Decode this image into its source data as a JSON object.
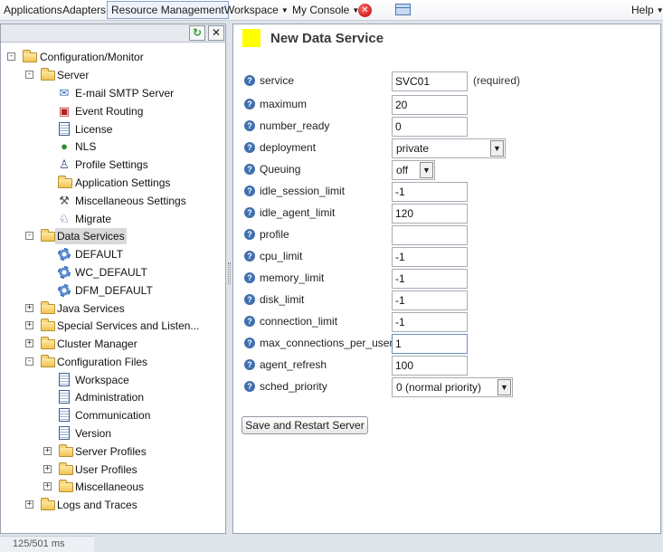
{
  "menu": {
    "applications": "Applications",
    "adapters": "Adapters",
    "resource_management": "Resource Management",
    "workspace": "Workspace",
    "my_console": "My Console",
    "help": "Help"
  },
  "tree": {
    "configuration_monitor": "Configuration/Monitor",
    "server": "Server",
    "email_smtp": "E-mail SMTP Server",
    "event_routing": "Event Routing",
    "license": "License",
    "nls": "NLS",
    "profile_settings": "Profile Settings",
    "application_settings": "Application Settings",
    "misc_settings": "Miscellaneous Settings",
    "migrate": "Migrate",
    "data_services": "Data Services",
    "default": "DEFAULT",
    "wc_default": "WC_DEFAULT",
    "dfm_default": "DFM_DEFAULT",
    "java_services": "Java Services",
    "special_services": "Special Services and Listen...",
    "cluster_manager": "Cluster Manager",
    "configuration_files": "Configuration Files",
    "cf_workspace": "Workspace",
    "cf_administration": "Administration",
    "cf_communication": "Communication",
    "cf_version": "Version",
    "server_profiles": "Server Profiles",
    "user_profiles": "User Profiles",
    "miscellaneous": "Miscellaneous",
    "logs_traces": "Logs and Traces"
  },
  "form": {
    "title": "New Data Service",
    "required_note": "(required)",
    "save_label": "Save and Restart Server",
    "fields": {
      "service": {
        "label": "service",
        "value": "SVC01"
      },
      "maximum": {
        "label": "maximum",
        "value": "20"
      },
      "number_ready": {
        "label": "number_ready",
        "value": "0"
      },
      "deployment": {
        "label": "deployment",
        "value": "private"
      },
      "queuing": {
        "label": "Queuing",
        "value": "off"
      },
      "idle_session_limit": {
        "label": "idle_session_limit",
        "value": "-1"
      },
      "idle_agent_limit": {
        "label": "idle_agent_limit",
        "value": "120"
      },
      "profile": {
        "label": "profile",
        "value": ""
      },
      "cpu_limit": {
        "label": "cpu_limit",
        "value": "-1"
      },
      "memory_limit": {
        "label": "memory_limit",
        "value": "-1"
      },
      "disk_limit": {
        "label": "disk_limit",
        "value": "-1"
      },
      "connection_limit": {
        "label": "connection_limit",
        "value": "-1"
      },
      "max_connections_per_user": {
        "label": "max_connections_per_user",
        "value": "1"
      },
      "agent_refresh": {
        "label": "agent_refresh",
        "value": "100"
      },
      "sched_priority": {
        "label": "sched_priority",
        "value": "0 (normal priority)"
      }
    }
  },
  "status": {
    "timing": "125/501 ms"
  },
  "colors": {
    "accent": "#ffff00",
    "help_icon": "#3f6fae",
    "selected_row": "#d9d9d9"
  }
}
